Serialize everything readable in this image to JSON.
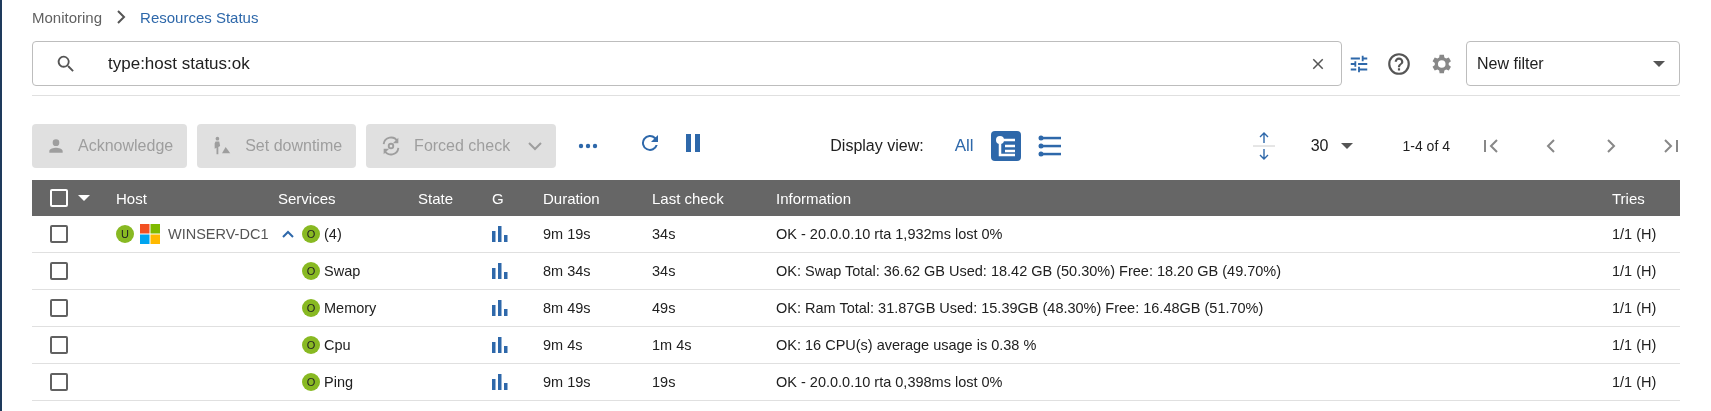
{
  "breadcrumb": {
    "parent": "Monitoring",
    "current": "Resources Status"
  },
  "search": {
    "value": "type:host status:ok"
  },
  "filter_select": {
    "value": "New filter"
  },
  "actions": [
    {
      "kind": "acknowledge",
      "label": "Acknowledge",
      "disabled": true
    },
    {
      "kind": "downtime",
      "label": "Set downtime",
      "disabled": true
    },
    {
      "kind": "check",
      "label": "Forced check",
      "disabled": true
    }
  ],
  "display_view": {
    "label": "Display view:",
    "options": [
      {
        "kind": "text",
        "label": "All",
        "selected": false
      },
      {
        "kind": "tree",
        "selected": true
      },
      {
        "kind": "list",
        "selected": false
      }
    ]
  },
  "pagination": {
    "page_size": "30",
    "range": "1-4 of 4"
  },
  "table": {
    "select_all_checked": false,
    "columns": [
      "Host",
      "Services",
      "State",
      "G",
      "Duration",
      "Last check",
      "Information",
      "Tries"
    ],
    "rows": [
      {
        "checked": false,
        "host": {
          "status": "U",
          "name": "WINSERV-DC1"
        },
        "service": {
          "status": "O",
          "name": "(4)",
          "expanded": true
        },
        "duration": "9m 19s",
        "last_check": "34s",
        "information": "OK - 20.0.0.10 rta 1,932ms lost 0%",
        "tries": "1/1 (H)"
      },
      {
        "checked": false,
        "service": {
          "status": "O",
          "name": "Swap"
        },
        "duration": "8m 34s",
        "last_check": "34s",
        "information": "OK: Swap Total: 36.62 GB Used: 18.42 GB (50.30%) Free: 18.20 GB (49.70%)",
        "tries": "1/1 (H)"
      },
      {
        "checked": false,
        "service": {
          "status": "O",
          "name": "Memory"
        },
        "duration": "8m 49s",
        "last_check": "49s",
        "information": "OK: Ram Total: 31.87GB Used: 15.39GB (48.30%) Free: 16.48GB (51.70%)",
        "tries": "1/1 (H)"
      },
      {
        "checked": false,
        "service": {
          "status": "O",
          "name": "Cpu"
        },
        "duration": "9m 4s",
        "last_check": "1m 4s",
        "information": "OK: 16 CPU(s) average usage is 0.38 %",
        "tries": "1/1 (H)"
      },
      {
        "checked": false,
        "service": {
          "status": "O",
          "name": "Ping"
        },
        "duration": "9m 19s",
        "last_check": "19s",
        "information": "OK - 20.0.0.10 rta 0,398ms lost 0%",
        "tries": "1/1 (H)"
      }
    ]
  }
}
